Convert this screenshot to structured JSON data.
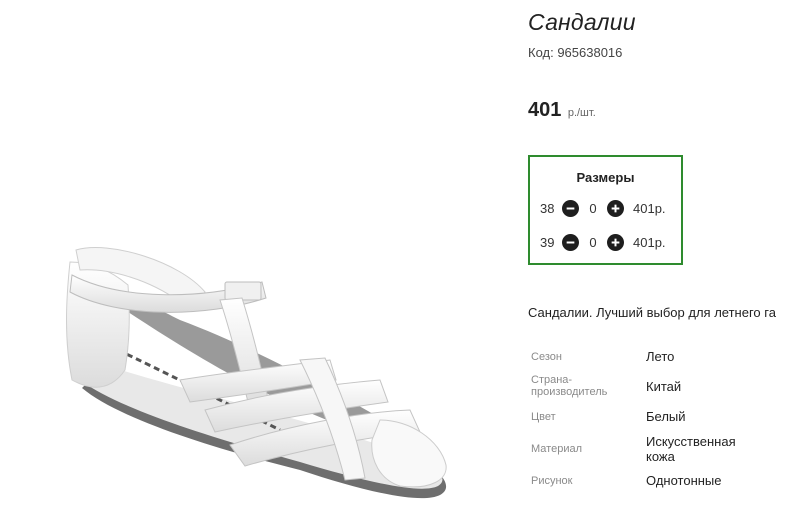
{
  "product": {
    "title": "Сандалии",
    "code_label": "Код: 965638016",
    "price_value": "401",
    "price_unit": "р./шт."
  },
  "sizes": {
    "title": "Размеры",
    "rows": [
      {
        "size": "38",
        "qty": "0",
        "price": "401р."
      },
      {
        "size": "39",
        "qty": "0",
        "price": "401р."
      }
    ]
  },
  "description": "Сандалии. Лучший выбор для летнего га",
  "specs": [
    {
      "label": "Сезон",
      "value": "Лето"
    },
    {
      "label": "Страна-\nпроизводитель",
      "value": "Китай"
    },
    {
      "label": "Цвет",
      "value": "Белый"
    },
    {
      "label": "Материал",
      "value": "Искусственная\nкожа"
    },
    {
      "label": "Рисунок",
      "value": "Однотонные"
    }
  ],
  "colors": {
    "border": "#2e8b2e",
    "button": "#1e1e1e"
  },
  "icons": [
    "minus-circle-icon",
    "plus-circle-icon"
  ]
}
